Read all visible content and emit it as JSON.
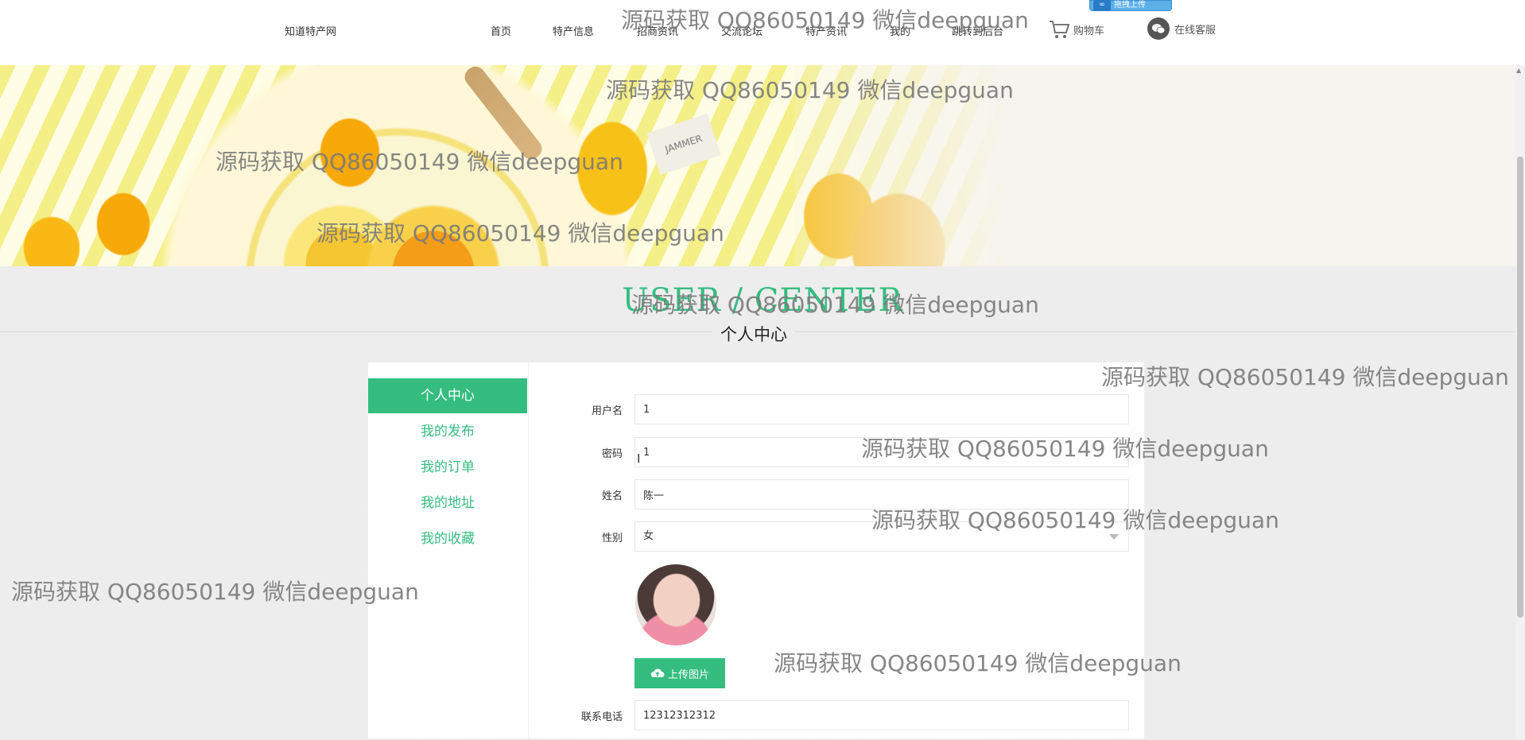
{
  "header": {
    "site_name": "知道特产网",
    "nav": [
      "首页",
      "特产信息",
      "招商资讯",
      "交流论坛",
      "特产资讯",
      "我的",
      "跳转到后台"
    ],
    "cart_label": "购物车",
    "service_label": "在线客服",
    "upload_badge": "拖拽上传"
  },
  "banner": {
    "tag_text": "JAMMER"
  },
  "page_title": {
    "en": "USER / CENTER",
    "cn": "个人中心"
  },
  "sidebar": {
    "items": [
      "个人中心",
      "我的发布",
      "我的订单",
      "我的地址",
      "我的收藏"
    ],
    "active_index": 0
  },
  "form": {
    "username_label": "用户名",
    "username_value": "1",
    "password_label": "密码",
    "password_value": "1",
    "name_label": "姓名",
    "name_value": "陈一",
    "gender_label": "性别",
    "gender_value": "女",
    "upload_label": "上传图片",
    "phone_label": "联系电话",
    "phone_value": "12312312312"
  },
  "watermark_text": "源码获取 QQ86050149 微信deepguan",
  "colors": {
    "accent": "#35bd80",
    "background": "#ededed"
  },
  "icons": [
    "cart-icon",
    "wechat-icon",
    "cloud-upload-icon",
    "chevron-down-icon"
  ]
}
